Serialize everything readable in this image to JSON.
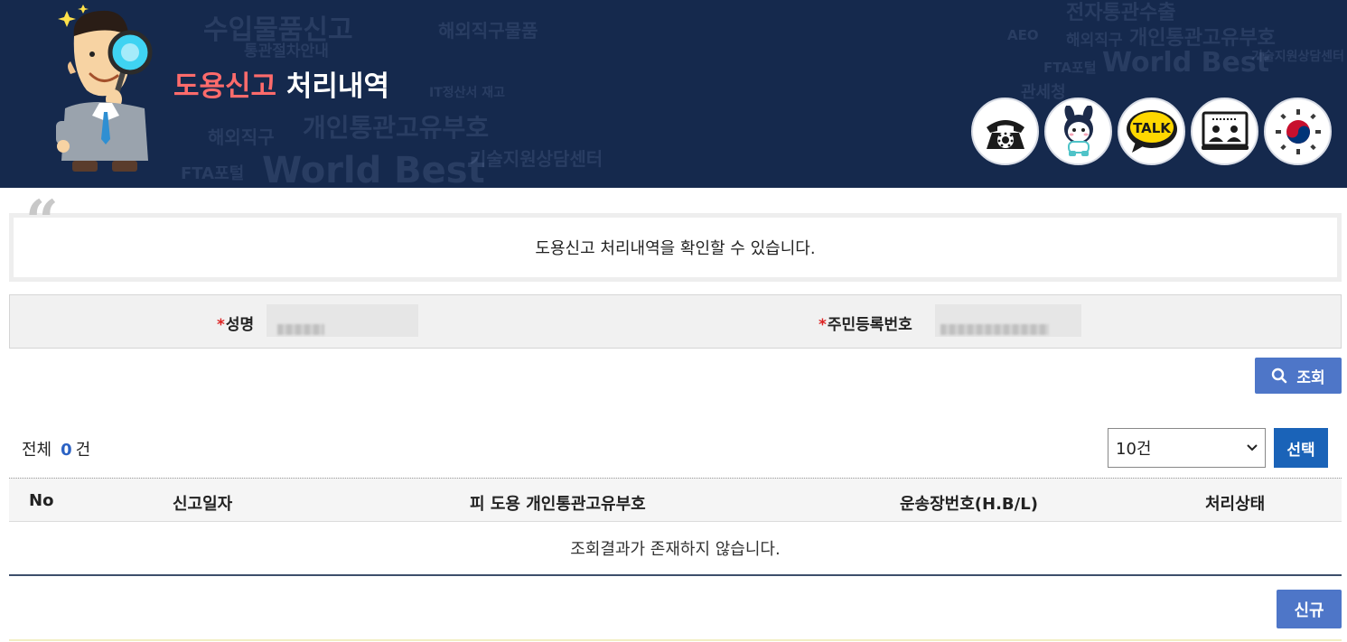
{
  "header": {
    "title_accent": "도용신고",
    "title_rest": "처리내역",
    "quick_icons": [
      "phone-icon",
      "mascot-icon",
      "kakaotalk-icon",
      "video-consult-icon",
      "government-emblem-icon"
    ],
    "talk_label": "TALK"
  },
  "intro": {
    "description": "도용신고 처리내역을 확인할 수 있습니다."
  },
  "search": {
    "required_mark": "*",
    "name_label": "성명",
    "rrn_label": "주민등록번호",
    "search_button": "조회"
  },
  "list": {
    "total_prefix": "전체",
    "total_count": "0",
    "total_suffix": "건",
    "per_page_selected": "10건",
    "select_button": "선택",
    "columns": [
      "No",
      "신고일자",
      "피 도용 개인통관고유부호",
      "운송장번호(H.B/L)",
      "처리상태"
    ],
    "empty_message": "조회결과가 존재하지 않습니다.",
    "new_button": "신규"
  },
  "colors": {
    "banner_bg": "#15294d",
    "title_accent": "#ff6b6b",
    "primary_button": "#4e76c8",
    "select_button": "#1a63b8",
    "count_color": "#2b62c4"
  }
}
